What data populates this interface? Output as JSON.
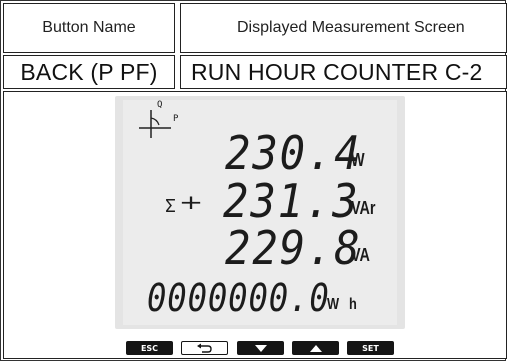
{
  "table": {
    "header_left": "Button Name",
    "header_right": "Displayed Measurement Screen",
    "row_left": "BACK (P PF)",
    "row_right": "RUN HOUR COUNTER  C-2"
  },
  "display": {
    "axis_q": "Q",
    "axis_p": "P",
    "line1_value": "230.4",
    "line1_unit": "W",
    "sigma": "Σ",
    "cap_symbol": "⊣⊢",
    "line2_value": "231.3",
    "line2_unit": "VAr",
    "line3_value": "229.8",
    "line3_unit": "VA",
    "counter_value": "0000000.0",
    "counter_unit": "W h"
  },
  "buttons": {
    "esc": "ESC",
    "back_icon": "back-arrow-icon",
    "down_icon": "down-triangle-icon",
    "up_icon": "up-triangle-icon",
    "set": "SET"
  }
}
